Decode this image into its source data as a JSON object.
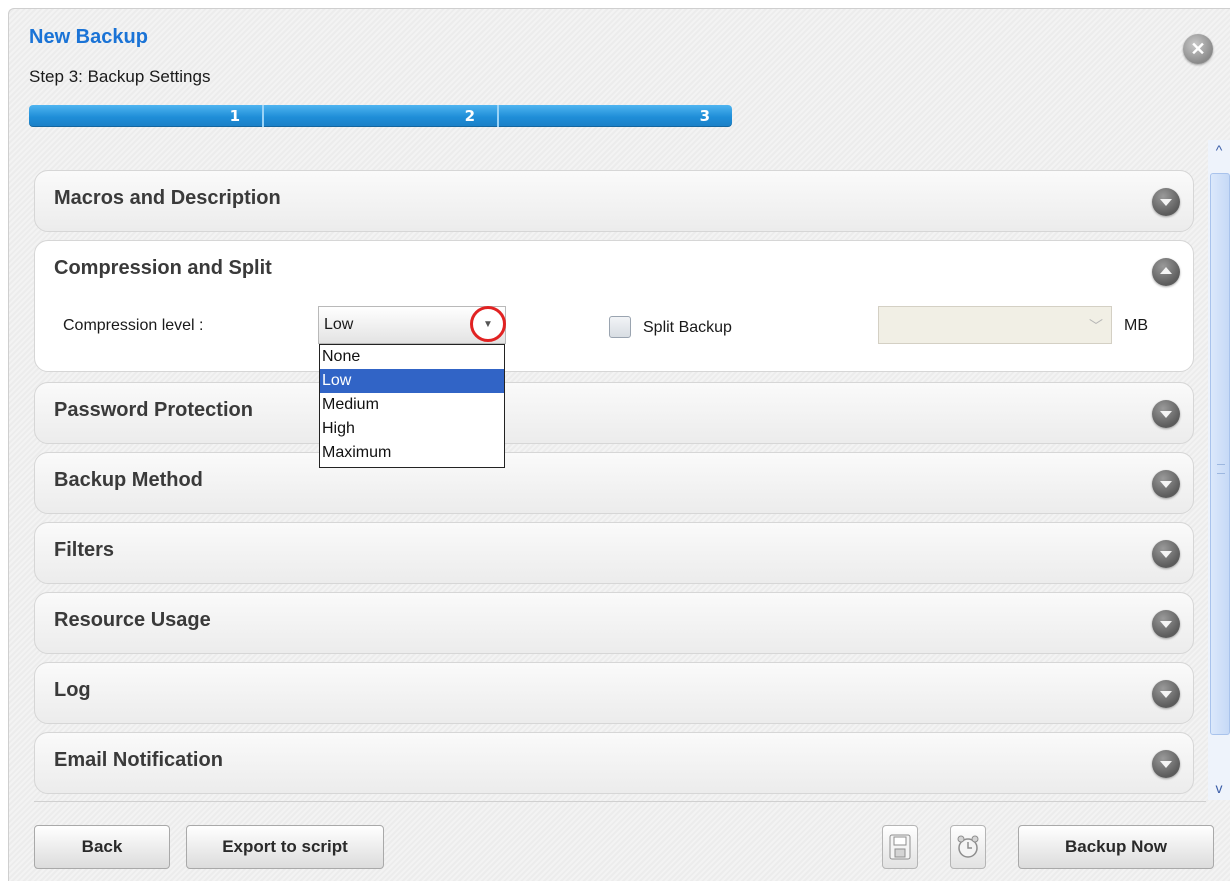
{
  "dialog": {
    "title": "New Backup",
    "step": "Step 3: Backup Settings",
    "progress_steps": [
      "1",
      "2",
      "3"
    ],
    "current_step": 3
  },
  "panels": [
    {
      "title": "Macros and Description",
      "expanded": false
    },
    {
      "title": "Compression and Split",
      "expanded": true
    },
    {
      "title": "Password Protection",
      "expanded": false
    },
    {
      "title": "Backup Method",
      "expanded": false
    },
    {
      "title": "Filters",
      "expanded": false
    },
    {
      "title": "Resource Usage",
      "expanded": false
    },
    {
      "title": "Log",
      "expanded": false
    },
    {
      "title": "Email Notification",
      "expanded": false
    }
  ],
  "compression": {
    "label": "Compression level :",
    "selected": "Low",
    "options": [
      "None",
      "Low",
      "Medium",
      "High",
      "Maximum"
    ],
    "split_label": "Split Backup",
    "split_checked": false,
    "size_value": "",
    "size_unit": "MB"
  },
  "footer": {
    "back": "Back",
    "export": "Export to script",
    "backup_now": "Backup Now",
    "save_icon": "floppy-disk-icon",
    "schedule_icon": "alarm-clock-icon"
  },
  "colors": {
    "title": "#1a73d6",
    "progress": "#1f8ed8",
    "selection": "#3164c6",
    "highlight_circle": "#e12222"
  }
}
